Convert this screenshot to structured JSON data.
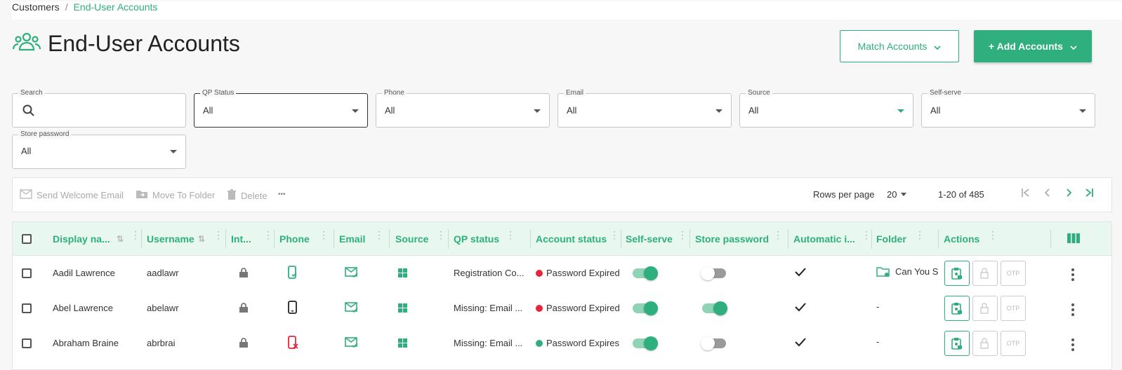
{
  "breadcrumb": {
    "parent": "Customers",
    "separator": "/",
    "current": "End-User Accounts"
  },
  "page": {
    "title": "End-User Accounts"
  },
  "header_buttons": {
    "match": "Match Accounts",
    "add": "+ Add Accounts"
  },
  "filters": {
    "search": {
      "label": "Search",
      "value": ""
    },
    "qp_status": {
      "label": "QP Status",
      "value": "All"
    },
    "phone": {
      "label": "Phone",
      "value": "All"
    },
    "email": {
      "label": "Email",
      "value": "All"
    },
    "source": {
      "label": "Source",
      "value": "All"
    },
    "self_serve": {
      "label": "Self-serve",
      "value": "All"
    },
    "store_password": {
      "label": "Store password",
      "value": "All"
    }
  },
  "toolbar": {
    "send_welcome": "Send Welcome Email",
    "move_folder": "Move To Folder",
    "delete": "Delete",
    "more": "•••",
    "rows_per_page_label": "Rows per page",
    "rows_per_page": "20",
    "range": "1-20 of 485"
  },
  "table": {
    "headers": [
      "Display na...",
      "Username",
      "Int...",
      "Phone",
      "Email",
      "Source",
      "QP status",
      "Account status",
      "Self-serve",
      "Store password",
      "Automatic i...",
      "Folder",
      "Actions"
    ],
    "rows": [
      {
        "display_name": "Aadil Lawrence",
        "username": "aadlawr",
        "phone_state": "ok",
        "qp_status": "Registration Co...",
        "account_status": "Password Expired",
        "status_color": "#e8263b",
        "self_serve": true,
        "store_password": false,
        "folder": "Can You Se",
        "folder_icon": "folder-icon"
      },
      {
        "display_name": "Abel Lawrence",
        "username": "abelawr",
        "phone_state": "plain",
        "qp_status": "Missing: Email ...",
        "account_status": "Password Expired",
        "status_color": "#e8263b",
        "self_serve": true,
        "store_password": true,
        "folder": "-",
        "folder_icon": ""
      },
      {
        "display_name": "Abraham Braine",
        "username": "abrbrai",
        "phone_state": "error",
        "qp_status": "Missing: Email ...",
        "account_status": "Password Expires",
        "status_color": "#2eaf7d",
        "self_serve": true,
        "store_password": false,
        "folder": "-",
        "folder_icon": ""
      }
    ],
    "otp_label": "OTP"
  },
  "colors": {
    "accent": "#2eaf7d",
    "danger": "#e8263b"
  }
}
